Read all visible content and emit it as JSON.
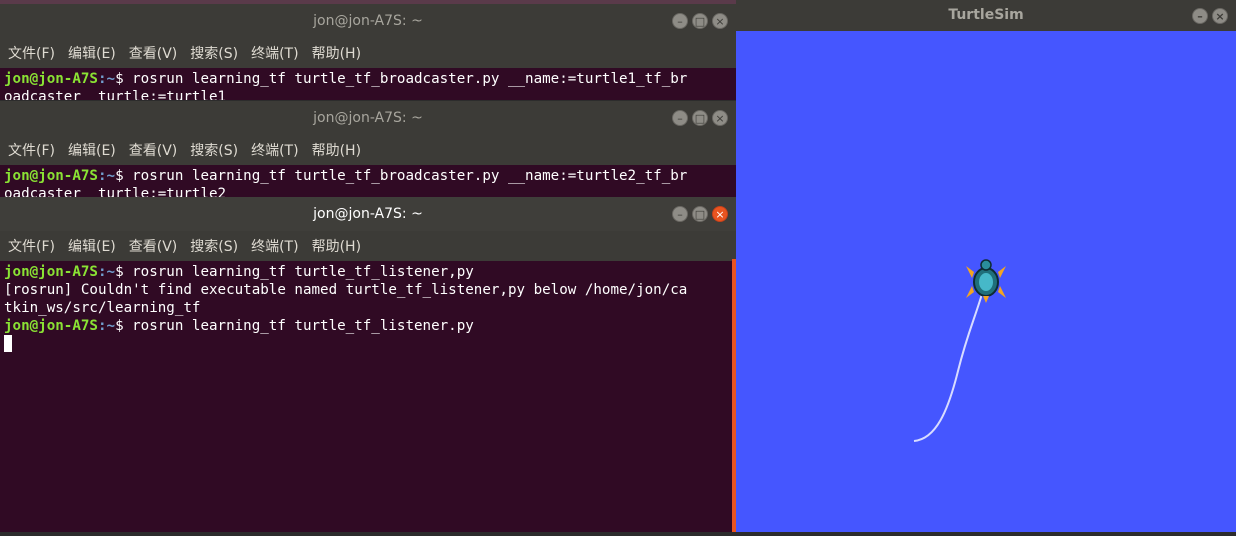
{
  "terminals": [
    {
      "title": "jon@jon-A7S: ~",
      "menu": [
        "文件(F)",
        "编辑(E)",
        "查看(V)",
        "搜索(S)",
        "终端(T)",
        "帮助(H)"
      ],
      "lines": [
        {
          "user": "jon@jon-A7S",
          "path": ":~",
          "cmd": "$ rosrun learning_tf turtle_tf_broadcaster.py __name:=turtle1_tf_br"
        },
        {
          "text": "oadcaster _turtle:=turtle1"
        }
      ]
    },
    {
      "title": "jon@jon-A7S: ~",
      "menu": [
        "文件(F)",
        "编辑(E)",
        "查看(V)",
        "搜索(S)",
        "终端(T)",
        "帮助(H)"
      ],
      "lines": [
        {
          "user": "jon@jon-A7S",
          "path": ":~",
          "cmd": "$ rosrun learning_tf turtle_tf_broadcaster.py __name:=turtle2_tf_br"
        },
        {
          "text": "oadcaster _turtle:=turtle2"
        }
      ]
    },
    {
      "title": "jon@jon-A7S: ~",
      "menu": [
        "文件(F)",
        "编辑(E)",
        "查看(V)",
        "搜索(S)",
        "终端(T)",
        "帮助(H)"
      ],
      "lines": [
        {
          "user": "jon@jon-A7S",
          "path": ":~",
          "cmd": "$ rosrun learning_tf turtle_tf_listener,py"
        },
        {
          "text": "[rosrun] Couldn't find executable named turtle_tf_listener,py below /home/jon/ca"
        },
        {
          "text": "tkin_ws/src/learning_tf"
        },
        {
          "user": "jon@jon-A7S",
          "path": ":~",
          "cmd": "$ rosrun learning_tf turtle_tf_listener.py"
        }
      ]
    }
  ],
  "window_buttons": {
    "minimize": "–",
    "maximize": "□",
    "close": "×"
  },
  "turtlesim": {
    "title": "TurtleSim",
    "background": "#4556ff",
    "turtle_icon": "turtle-sprite",
    "trail_color": "#d8dcff"
  }
}
